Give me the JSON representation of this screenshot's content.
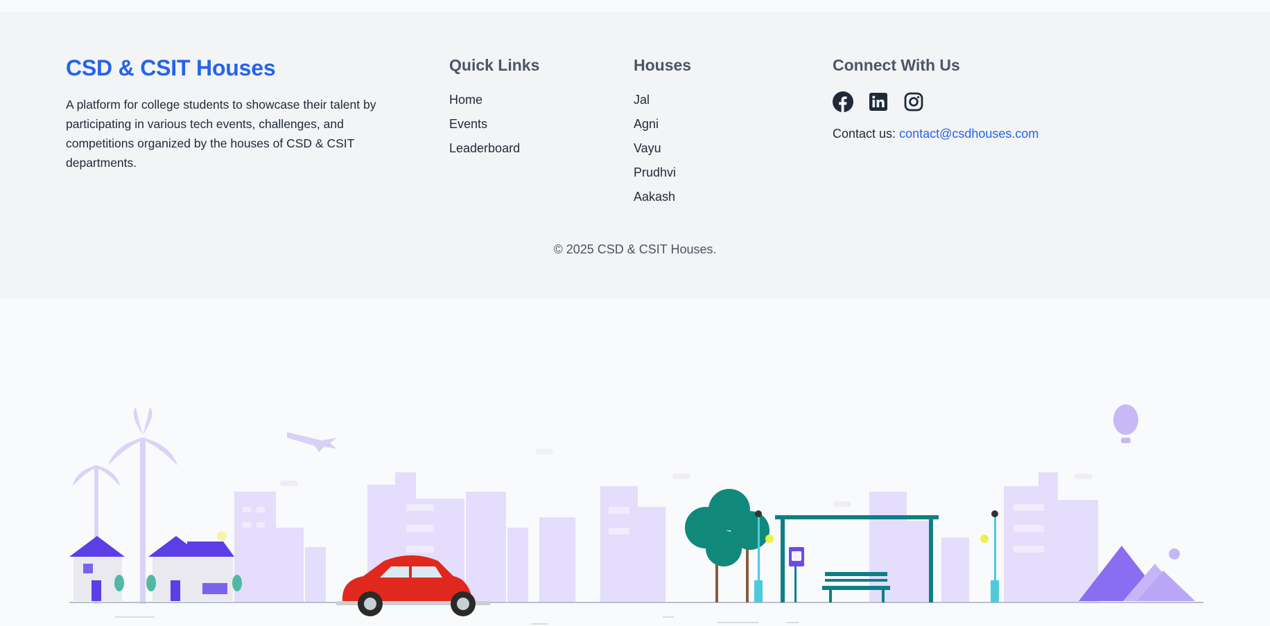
{
  "brand": {
    "title": "CSD & CSIT Houses",
    "description": "A platform for college students to showcase their talent by participating in various tech events, challenges, and competitions organized by the houses of CSD & CSIT departments."
  },
  "quick_links": {
    "title": "Quick Links",
    "items": [
      "Home",
      "Events",
      "Leaderboard"
    ]
  },
  "houses": {
    "title": "Houses",
    "items": [
      "Jal",
      "Agni",
      "Vayu",
      "Prudhvi",
      "Aakash"
    ]
  },
  "connect": {
    "title": "Connect With Us",
    "icons": [
      "facebook-icon",
      "linkedin-icon",
      "instagram-icon"
    ],
    "contact_label": "Contact us:",
    "contact_email": "contact@csdhouses.com"
  },
  "copyright": "© 2025 CSD & CSIT Houses.",
  "colors": {
    "accent": "#2563eb",
    "footer_bg": "#f3f4f6",
    "illustration_purple": "#e4ddfb",
    "car_red": "#e0281e",
    "bus_stop_teal": "#0f7f86"
  }
}
